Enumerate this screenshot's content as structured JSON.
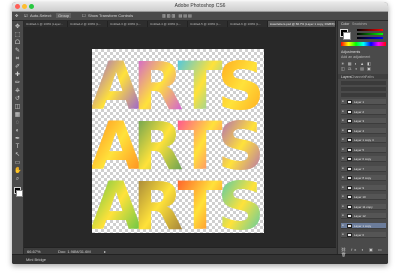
{
  "window": {
    "title": "Adobe Photoshop CS6",
    "traffic_colors": [
      "#ff5f57",
      "#ffbd2e",
      "#28c840"
    ]
  },
  "options_bar": {
    "auto_select_label": "Auto-Select:",
    "auto_select_value": "Group",
    "transform_label": "Show Transform Controls"
  },
  "tabs": [
    {
      "label": "Untitled-1 @ 100% (Layer..."
    },
    {
      "label": "Untitled-2 @ 100% (L..."
    },
    {
      "label": "Untitled-3 @ 100% (L..."
    },
    {
      "label": "Untitled-4 @ 100% (L..."
    },
    {
      "label": "Untitled-5 @ 100% (L..."
    },
    {
      "label": "Untitled-6 @ 100% (L..."
    },
    {
      "label": "lowerletters.psd @ 66.7% (Layer 1 copy, RGB/8)"
    }
  ],
  "art": {
    "rows": [
      [
        "A",
        "R",
        "T",
        "S"
      ],
      [
        "A",
        "R",
        "T",
        "S"
      ],
      [
        "A",
        "R",
        "T",
        "S"
      ]
    ],
    "colors": [
      [
        "#7d3cff",
        "#c43cff",
        "#2fc2ff",
        "#ff9d1a"
      ],
      [
        "#ff7a1a",
        "#3f8f5a",
        "#ff3aa0",
        "#9a4bd8"
      ],
      [
        "#3fbf4a",
        "#8a6a3a",
        "#ff4a2a",
        "#24c4c8"
      ]
    ]
  },
  "status": {
    "zoom": "66.67%",
    "doc_label": "Doc: 1.98M/31.6M"
  },
  "timeline": {
    "label": "Mini Bridge"
  },
  "panels": {
    "color_tab": "Color",
    "swatches_tab": "Swatches",
    "adjustments_tab": "Adjustments",
    "add_adjustment": "Add an adjustment",
    "layers_tab": "Layers",
    "channels_tab": "Channels",
    "paths_tab": "Paths",
    "layers": [
      {
        "name": "Layer 1"
      },
      {
        "name": "Layer 2"
      },
      {
        "name": "Layer 3"
      },
      {
        "name": "Layer 4"
      },
      {
        "name": "Layer 1 copy 4"
      },
      {
        "name": "Layer 5"
      },
      {
        "name": "Layer 6 copy"
      },
      {
        "name": "Layer 7"
      },
      {
        "name": "Layer 8 copy"
      },
      {
        "name": "Layer 9"
      },
      {
        "name": "Layer 10"
      },
      {
        "name": "Layer 11 copy"
      },
      {
        "name": "Layer 12"
      },
      {
        "name": "Layer 1 copy",
        "selected": true
      },
      {
        "name": "Layer 0"
      }
    ]
  },
  "tools": [
    "move-icon",
    "marquee-icon",
    "lasso-icon",
    "quick-select-icon",
    "crop-icon",
    "eyedropper-icon",
    "healing-icon",
    "brush-icon",
    "stamp-icon",
    "history-brush-icon",
    "eraser-icon",
    "gradient-icon",
    "blur-icon",
    "dodge-icon",
    "pen-icon",
    "type-icon",
    "path-select-icon",
    "shape-icon",
    "hand-icon",
    "zoom-icon"
  ]
}
